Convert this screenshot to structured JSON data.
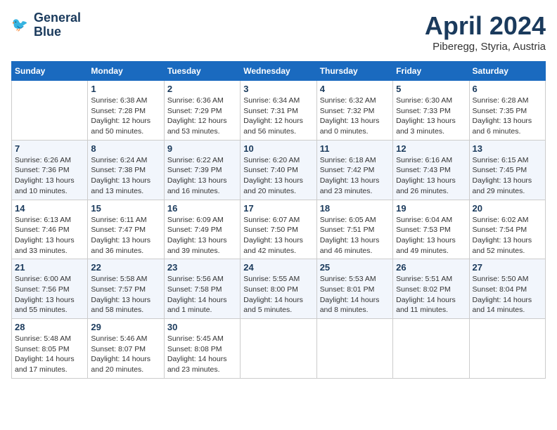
{
  "header": {
    "logo_line1": "General",
    "logo_line2": "Blue",
    "month": "April 2024",
    "location": "Piberegg, Styria, Austria"
  },
  "weekdays": [
    "Sunday",
    "Monday",
    "Tuesday",
    "Wednesday",
    "Thursday",
    "Friday",
    "Saturday"
  ],
  "weeks": [
    [
      {
        "day": "",
        "info": ""
      },
      {
        "day": "1",
        "info": "Sunrise: 6:38 AM\nSunset: 7:28 PM\nDaylight: 12 hours\nand 50 minutes."
      },
      {
        "day": "2",
        "info": "Sunrise: 6:36 AM\nSunset: 7:29 PM\nDaylight: 12 hours\nand 53 minutes."
      },
      {
        "day": "3",
        "info": "Sunrise: 6:34 AM\nSunset: 7:31 PM\nDaylight: 12 hours\nand 56 minutes."
      },
      {
        "day": "4",
        "info": "Sunrise: 6:32 AM\nSunset: 7:32 PM\nDaylight: 13 hours\nand 0 minutes."
      },
      {
        "day": "5",
        "info": "Sunrise: 6:30 AM\nSunset: 7:33 PM\nDaylight: 13 hours\nand 3 minutes."
      },
      {
        "day": "6",
        "info": "Sunrise: 6:28 AM\nSunset: 7:35 PM\nDaylight: 13 hours\nand 6 minutes."
      }
    ],
    [
      {
        "day": "7",
        "info": "Sunrise: 6:26 AM\nSunset: 7:36 PM\nDaylight: 13 hours\nand 10 minutes."
      },
      {
        "day": "8",
        "info": "Sunrise: 6:24 AM\nSunset: 7:38 PM\nDaylight: 13 hours\nand 13 minutes."
      },
      {
        "day": "9",
        "info": "Sunrise: 6:22 AM\nSunset: 7:39 PM\nDaylight: 13 hours\nand 16 minutes."
      },
      {
        "day": "10",
        "info": "Sunrise: 6:20 AM\nSunset: 7:40 PM\nDaylight: 13 hours\nand 20 minutes."
      },
      {
        "day": "11",
        "info": "Sunrise: 6:18 AM\nSunset: 7:42 PM\nDaylight: 13 hours\nand 23 minutes."
      },
      {
        "day": "12",
        "info": "Sunrise: 6:16 AM\nSunset: 7:43 PM\nDaylight: 13 hours\nand 26 minutes."
      },
      {
        "day": "13",
        "info": "Sunrise: 6:15 AM\nSunset: 7:45 PM\nDaylight: 13 hours\nand 29 minutes."
      }
    ],
    [
      {
        "day": "14",
        "info": "Sunrise: 6:13 AM\nSunset: 7:46 PM\nDaylight: 13 hours\nand 33 minutes."
      },
      {
        "day": "15",
        "info": "Sunrise: 6:11 AM\nSunset: 7:47 PM\nDaylight: 13 hours\nand 36 minutes."
      },
      {
        "day": "16",
        "info": "Sunrise: 6:09 AM\nSunset: 7:49 PM\nDaylight: 13 hours\nand 39 minutes."
      },
      {
        "day": "17",
        "info": "Sunrise: 6:07 AM\nSunset: 7:50 PM\nDaylight: 13 hours\nand 42 minutes."
      },
      {
        "day": "18",
        "info": "Sunrise: 6:05 AM\nSunset: 7:51 PM\nDaylight: 13 hours\nand 46 minutes."
      },
      {
        "day": "19",
        "info": "Sunrise: 6:04 AM\nSunset: 7:53 PM\nDaylight: 13 hours\nand 49 minutes."
      },
      {
        "day": "20",
        "info": "Sunrise: 6:02 AM\nSunset: 7:54 PM\nDaylight: 13 hours\nand 52 minutes."
      }
    ],
    [
      {
        "day": "21",
        "info": "Sunrise: 6:00 AM\nSunset: 7:56 PM\nDaylight: 13 hours\nand 55 minutes."
      },
      {
        "day": "22",
        "info": "Sunrise: 5:58 AM\nSunset: 7:57 PM\nDaylight: 13 hours\nand 58 minutes."
      },
      {
        "day": "23",
        "info": "Sunrise: 5:56 AM\nSunset: 7:58 PM\nDaylight: 14 hours\nand 1 minute."
      },
      {
        "day": "24",
        "info": "Sunrise: 5:55 AM\nSunset: 8:00 PM\nDaylight: 14 hours\nand 5 minutes."
      },
      {
        "day": "25",
        "info": "Sunrise: 5:53 AM\nSunset: 8:01 PM\nDaylight: 14 hours\nand 8 minutes."
      },
      {
        "day": "26",
        "info": "Sunrise: 5:51 AM\nSunset: 8:02 PM\nDaylight: 14 hours\nand 11 minutes."
      },
      {
        "day": "27",
        "info": "Sunrise: 5:50 AM\nSunset: 8:04 PM\nDaylight: 14 hours\nand 14 minutes."
      }
    ],
    [
      {
        "day": "28",
        "info": "Sunrise: 5:48 AM\nSunset: 8:05 PM\nDaylight: 14 hours\nand 17 minutes."
      },
      {
        "day": "29",
        "info": "Sunrise: 5:46 AM\nSunset: 8:07 PM\nDaylight: 14 hours\nand 20 minutes."
      },
      {
        "day": "30",
        "info": "Sunrise: 5:45 AM\nSunset: 8:08 PM\nDaylight: 14 hours\nand 23 minutes."
      },
      {
        "day": "",
        "info": ""
      },
      {
        "day": "",
        "info": ""
      },
      {
        "day": "",
        "info": ""
      },
      {
        "day": "",
        "info": ""
      }
    ]
  ]
}
